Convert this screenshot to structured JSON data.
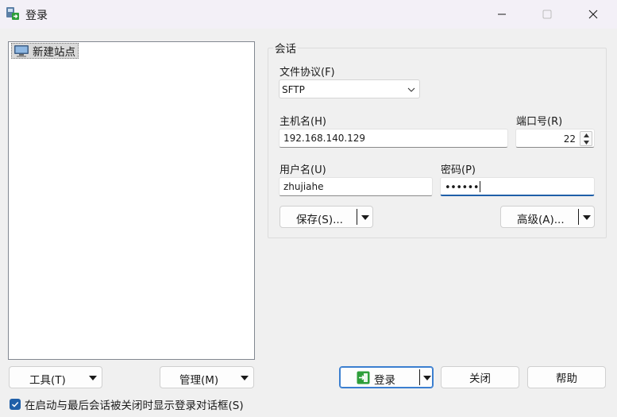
{
  "window": {
    "title": "登录",
    "app_icon": "winscp-login-icon",
    "controls": [
      "minimize",
      "maximize",
      "close"
    ]
  },
  "site_tree": {
    "items": [
      {
        "label": "新建站点",
        "icon": "computer-icon"
      }
    ]
  },
  "session": {
    "group_label": "会话",
    "protocol_label": "文件协议(F)",
    "protocol_value": "SFTP",
    "host_label": "主机名(H)",
    "host_value": "192.168.140.129",
    "port_label": "端口号(R)",
    "port_value": "22",
    "user_label": "用户名(U)",
    "user_value": "zhujiahe",
    "password_label": "密码(P)",
    "password_value": "••••••",
    "save_label": "保存(S)...",
    "advanced_label": "高级(A)..."
  },
  "bottom": {
    "tools_label": "工具(T)",
    "manage_label": "管理(M)",
    "login_label": "登录",
    "close_label": "关闭",
    "help_label": "帮助",
    "show_dialog_label": "在启动与最后会话被关闭时显示登录对话框(S)",
    "show_dialog_checked": true
  },
  "colors": {
    "accent": "#1f5fa8",
    "login_icon_green": "#2e9e3a",
    "titlebar_bg": "#f3f0f7",
    "window_bg": "#f0f0f0"
  }
}
